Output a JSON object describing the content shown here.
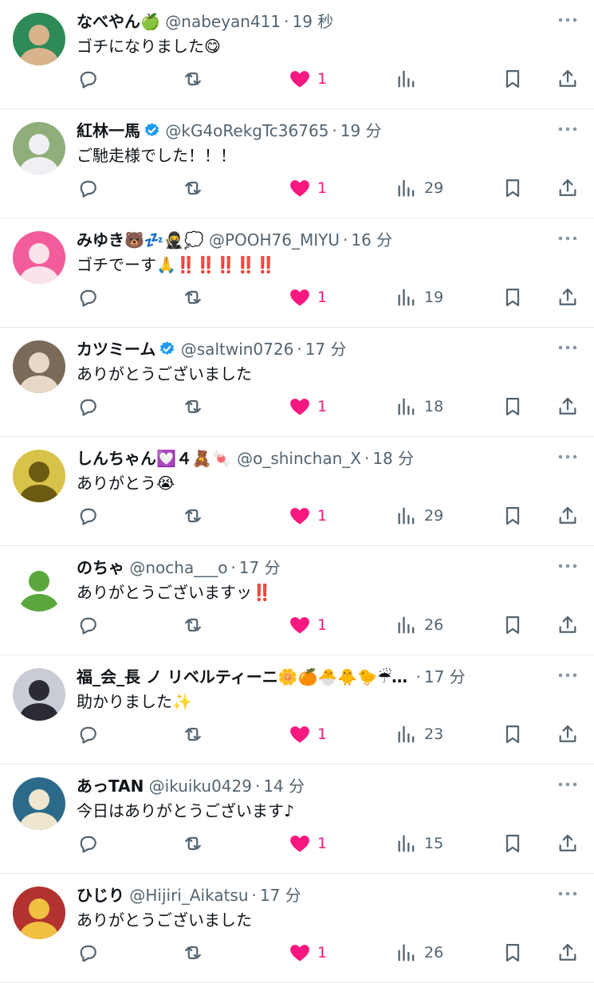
{
  "tweets": [
    {
      "name": "なべやん🍏",
      "verified": false,
      "handle": "@nabeyan411",
      "time": "19 秒",
      "text": "ゴチになりました😋",
      "likes": "1",
      "views": "",
      "avatar": {
        "bg": "#2e8b57",
        "fg": "#d9b38c"
      }
    },
    {
      "name": "紅林一馬",
      "verified": true,
      "handle": "@kG4oRekgTc36765",
      "time": "19 分",
      "text": "ご馳走様でした！！！",
      "likes": "1",
      "views": "29",
      "avatar": {
        "bg": "#8fae7a",
        "fg": "#f0f0f4"
      }
    },
    {
      "name": "みゆき🐻💤🥷💭",
      "verified": false,
      "handle": "@POOH76_MIYU",
      "time": "16 分",
      "text": "ゴチでーす🙏‼️‼️‼️‼️‼️",
      "likes": "1",
      "views": "19",
      "avatar": {
        "bg": "#f25c9a",
        "fg": "#fbe3ea"
      }
    },
    {
      "name": "カツミーム",
      "verified": true,
      "handle": "@saltwin0726",
      "time": "17 分",
      "text": "ありがとうございました",
      "likes": "1",
      "views": "18",
      "avatar": {
        "bg": "#7a6a58",
        "fg": "#e8d9c6"
      }
    },
    {
      "name": "しんちゃん💟４🧸🍬",
      "verified": false,
      "handle": "@o_shinchan_X",
      "time": "18 分",
      "text": "ありがとう😭",
      "likes": "1",
      "views": "29",
      "avatar": {
        "bg": "#d9c24a",
        "fg": "#6b5b10"
      }
    },
    {
      "name": "のちゃ",
      "verified": false,
      "handle": "@nocha___o",
      "time": "17 分",
      "text": "ありがとうございますッ‼️",
      "likes": "1",
      "views": "26",
      "avatar": {
        "bg": "#ffffff",
        "fg": "#5aa83c"
      }
    },
    {
      "name": "福_会_長 ノ リベルティーニ🌼🍊🐣🐥🐤☔…",
      "verified": false,
      "handle": "",
      "time": "17 分",
      "text": "助かりました✨",
      "likes": "1",
      "views": "23",
      "avatar": {
        "bg": "#c9ccd4",
        "fg": "#2b2b35"
      }
    },
    {
      "name": "あっTAN",
      "verified": false,
      "handle": "@ikuiku0429",
      "time": "14 分",
      "text": "今日はありがとうございます♪",
      "likes": "1",
      "views": "15",
      "avatar": {
        "bg": "#2d6a8a",
        "fg": "#efe6cf"
      }
    },
    {
      "name": "ひじり",
      "verified": false,
      "handle": "@Hijiri_Aikatsu",
      "time": "17 分",
      "text": "ありがとうございました",
      "likes": "1",
      "views": "26",
      "avatar": {
        "bg": "#b2322f",
        "fg": "#f0c040"
      }
    }
  ],
  "separator": "·",
  "colors": {
    "accent_like": "#f91880",
    "icon": "#536471",
    "verified": "#1d9bf0",
    "divider": "#e6e9ec"
  },
  "icons": [
    "reply-icon",
    "retweet-icon",
    "like-icon",
    "views-icon",
    "bookmark-icon",
    "share-icon",
    "more-icon",
    "verified-badge-icon"
  ]
}
